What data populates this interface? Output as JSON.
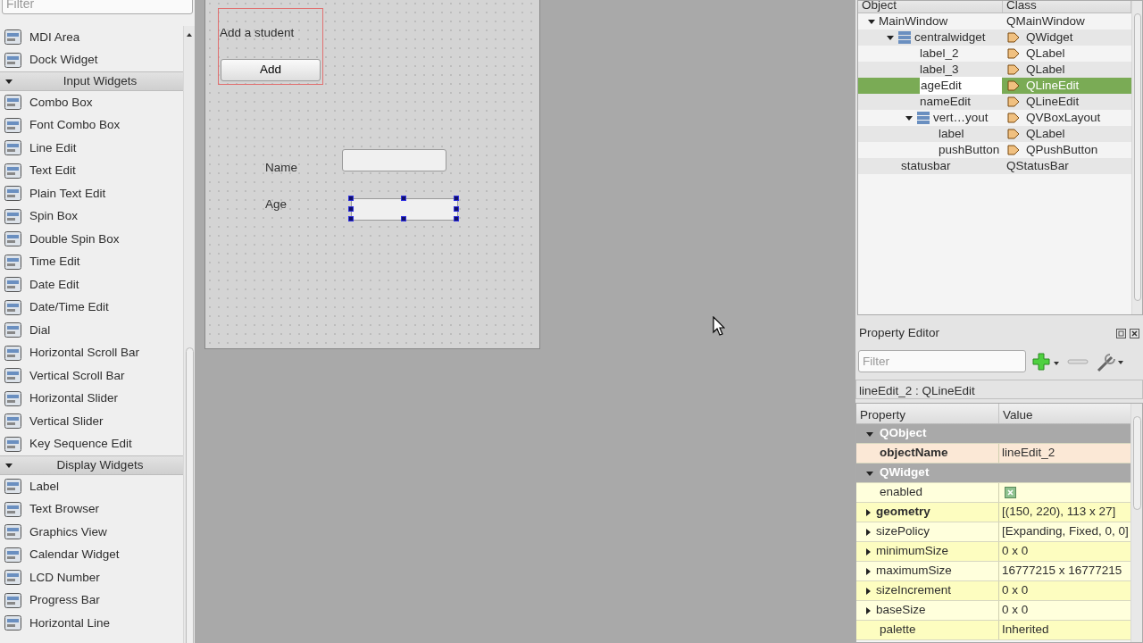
{
  "widget_box": {
    "filter": {
      "placeholder": "Filter"
    },
    "groups": [
      {
        "items": [
          {
            "label": "MDI Area"
          },
          {
            "label": "Dock Widget"
          }
        ]
      },
      {
        "title": "Input Widgets",
        "expanded": true,
        "items": [
          {
            "label": "Combo Box"
          },
          {
            "label": "Font Combo Box"
          },
          {
            "label": "Line Edit"
          },
          {
            "label": "Text Edit"
          },
          {
            "label": "Plain Text Edit"
          },
          {
            "label": "Spin Box"
          },
          {
            "label": "Double Spin Box"
          },
          {
            "label": "Time Edit"
          },
          {
            "label": "Date Edit"
          },
          {
            "label": "Date/Time Edit"
          },
          {
            "label": "Dial"
          },
          {
            "label": "Horizontal Scroll Bar"
          },
          {
            "label": "Vertical Scroll Bar"
          },
          {
            "label": "Horizontal Slider"
          },
          {
            "label": "Vertical Slider"
          },
          {
            "label": "Key Sequence Edit"
          }
        ]
      },
      {
        "title": "Display Widgets",
        "expanded": true,
        "items": [
          {
            "label": "Label"
          },
          {
            "label": "Text Browser"
          },
          {
            "label": "Graphics View"
          },
          {
            "label": "Calendar Widget"
          },
          {
            "label": "LCD Number"
          },
          {
            "label": "Progress Bar"
          },
          {
            "label": "Horizontal Line"
          }
        ]
      }
    ]
  },
  "form": {
    "layout_box": {
      "label": "Add a student",
      "button": "Add"
    },
    "fields": [
      {
        "label": "Name",
        "selected": false
      },
      {
        "label": "Age",
        "selected": true
      }
    ]
  },
  "object_inspector": {
    "columns": [
      "Object",
      "Class"
    ],
    "tree": [
      {
        "name": "MainWindow",
        "class": "QMainWindow",
        "icon": false,
        "class_icon": false,
        "selected": false,
        "expanded": true,
        "children": [
          {
            "name": "centralwidget",
            "class": "QWidget",
            "icon": true,
            "class_icon": true,
            "selected": false,
            "expanded": true,
            "children": [
              {
                "name": "label_2",
                "class": "QLabel",
                "icon": false,
                "class_icon": true,
                "selected": false
              },
              {
                "name": "label_3",
                "class": "QLabel",
                "icon": false,
                "class_icon": true,
                "selected": false
              },
              {
                "name": "ageEdit",
                "class": "QLineEdit",
                "icon": false,
                "class_icon": true,
                "selected": true,
                "editing": true
              },
              {
                "name": "nameEdit",
                "class": "QLineEdit",
                "icon": false,
                "class_icon": true,
                "selected": false
              },
              {
                "name": "vert…yout",
                "class": "QVBoxLayout",
                "icon": true,
                "class_icon": true,
                "selected": false,
                "expanded": true,
                "children": [
                  {
                    "name": "label",
                    "class": "QLabel",
                    "icon": false,
                    "class_icon": true,
                    "selected": false
                  },
                  {
                    "name": "pushButton",
                    "class": "QPushButton",
                    "icon": false,
                    "class_icon": true,
                    "selected": false
                  }
                ]
              }
            ]
          },
          {
            "name": "statusbar",
            "class": "QStatusBar",
            "icon": false,
            "class_icon": false,
            "selected": false
          }
        ]
      }
    ]
  },
  "property_editor": {
    "title": "Property Editor",
    "filter": {
      "placeholder": "Filter"
    },
    "object_label": "lineEdit_2 : QLineEdit",
    "columns": [
      "Property",
      "Value"
    ],
    "rows": [
      {
        "kind": "section",
        "name": "QObject",
        "expanded": true
      },
      {
        "kind": "property",
        "name": "objectName",
        "value": "lineEdit_2",
        "modified": true,
        "expandable": false,
        "color": "#fbe8d6"
      },
      {
        "kind": "section",
        "name": "QWidget",
        "expanded": true
      },
      {
        "kind": "checkbox",
        "name": "enabled",
        "checked": true,
        "modified": false,
        "expandable": false,
        "color": "#ffffdc"
      },
      {
        "kind": "property",
        "name": "geometry",
        "value": "[(150, 220), 113 x 27]",
        "modified": true,
        "expandable": true,
        "color": "#fdfdc0"
      },
      {
        "kind": "property",
        "name": "sizePolicy",
        "value": "[Expanding, Fixed, 0, 0]",
        "modified": false,
        "expandable": true,
        "color": "#ffffdc"
      },
      {
        "kind": "property",
        "name": "minimumSize",
        "value": "0 x 0",
        "modified": false,
        "expandable": true,
        "color": "#fdfdc0"
      },
      {
        "kind": "property",
        "name": "maximumSize",
        "value": "16777215 x 16777215",
        "modified": false,
        "expandable": true,
        "color": "#ffffdc"
      },
      {
        "kind": "property",
        "name": "sizeIncrement",
        "value": "0 x 0",
        "modified": false,
        "expandable": true,
        "color": "#fdfdc0"
      },
      {
        "kind": "property",
        "name": "baseSize",
        "value": "0 x 0",
        "modified": false,
        "expandable": true,
        "color": "#ffffdc"
      },
      {
        "kind": "property",
        "name": "palette",
        "value": "Inherited",
        "modified": false,
        "expandable": false,
        "color": "#fdfdc0"
      }
    ]
  }
}
